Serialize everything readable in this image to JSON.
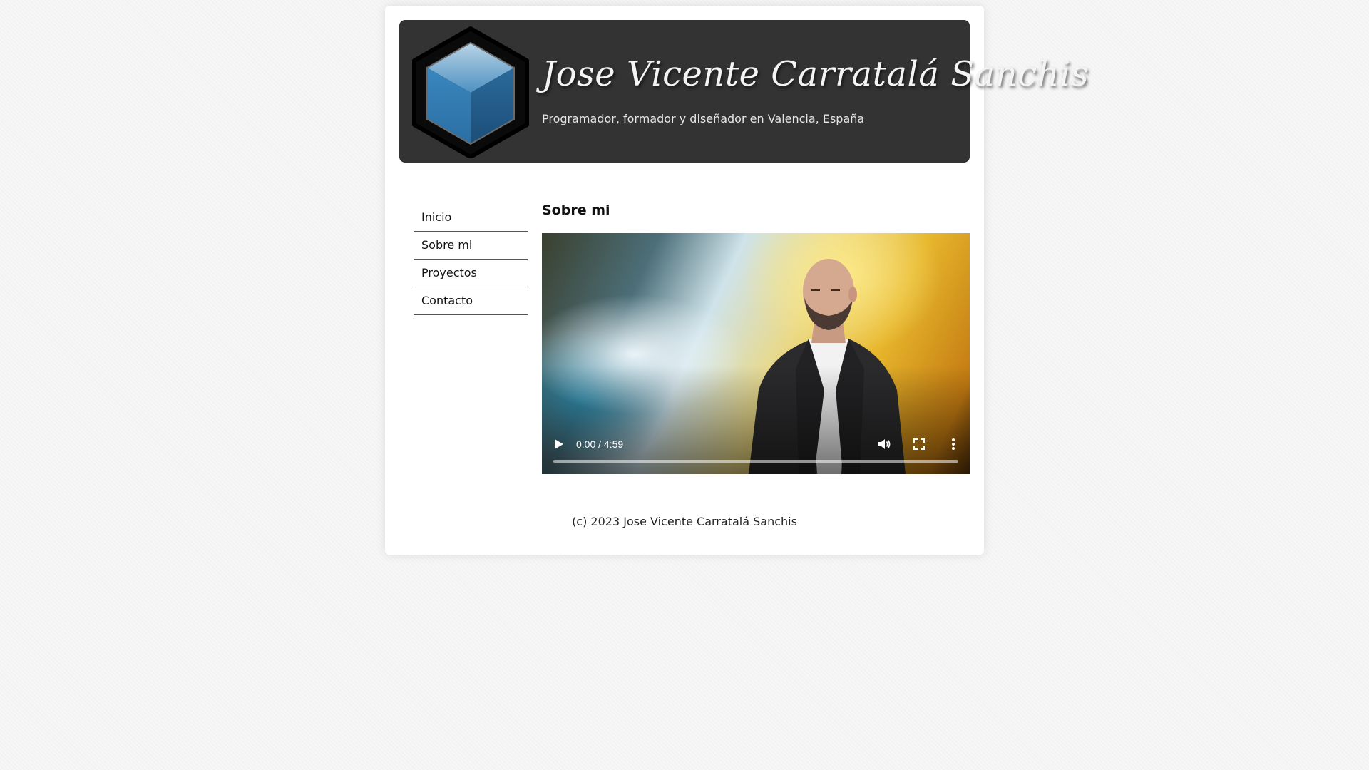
{
  "header": {
    "title": "Jose Vicente Carratalá Sanchis",
    "subtitle": "Programador, formador y diseñador en Valencia, España"
  },
  "nav": {
    "items": [
      {
        "label": "Inicio"
      },
      {
        "label": "Sobre mi"
      },
      {
        "label": "Proyectos"
      },
      {
        "label": "Contacto"
      }
    ]
  },
  "main": {
    "title": "Sobre mi",
    "video": {
      "time": "0:00 / 4:59",
      "progress": 0
    }
  },
  "footer": {
    "text": "(c) 2023 Jose Vicente Carratalá Sanchis"
  },
  "colors": {
    "header_bg": "#333333",
    "logo_blue": "#2f7fb8",
    "page_bg": "#ffffff"
  }
}
